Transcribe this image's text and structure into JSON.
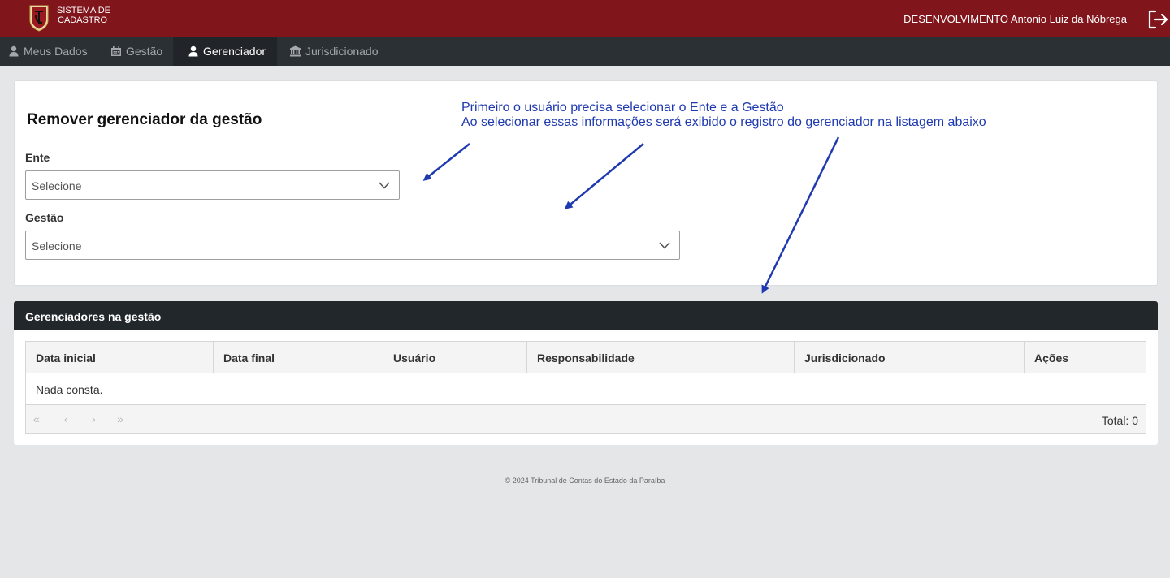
{
  "brand": {
    "line1": "SISTEMA DE",
    "line2": "CADASTRO"
  },
  "header": {
    "user": "DESENVOLVIMENTO Antonio Luiz da Nóbrega"
  },
  "nav": [
    {
      "label": "Meus Dados",
      "icon": "user-icon",
      "active": false
    },
    {
      "label": "Gestão",
      "icon": "calendar-icon",
      "active": false
    },
    {
      "label": "Gerenciador",
      "icon": "user-icon",
      "active": true
    },
    {
      "label": "Jurisdicionado",
      "icon": "bank-icon",
      "active": false
    }
  ],
  "form": {
    "title": "Remover gerenciador da gestão",
    "ente_label": "Ente",
    "ente_value": "Selecione",
    "gestao_label": "Gestão",
    "gestao_value": "Selecione"
  },
  "annotation": {
    "line1": "Primeiro o usuário precisa selecionar o Ente e a Gestão",
    "line2": "Ao selecionar essas informações será exibido o registro do gerenciador na listagem abaixo"
  },
  "table": {
    "title": "Gerenciadores na gestão",
    "columns": [
      "Data inicial",
      "Data final",
      "Usuário",
      "Responsabilidade",
      "Jurisdicionado",
      "Ações"
    ],
    "empty": "Nada consta.",
    "pager": {
      "first": "«",
      "prev": "‹",
      "next": "›",
      "last": "»"
    },
    "total": "Total: 0"
  },
  "footer": "© 2024 Tribunal de Contas do Estado da Paraíba",
  "colors": {
    "topbar": "#80151b",
    "navbar": "#2b3035",
    "annotation": "#1f3ab0"
  }
}
